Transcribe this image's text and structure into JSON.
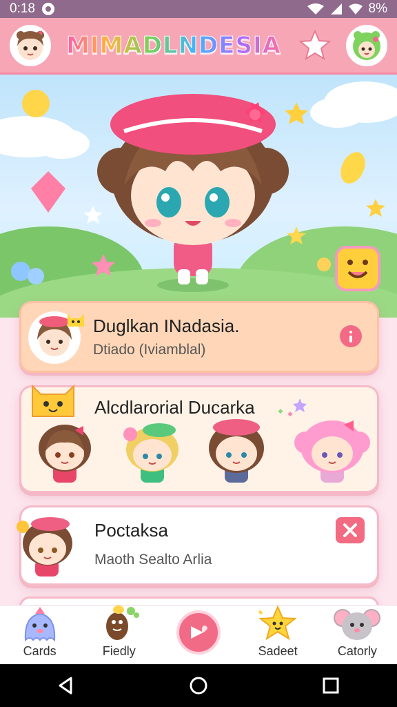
{
  "status_bar": {
    "time": "0:18",
    "battery": "8%"
  },
  "header": {
    "title": "MIMADLNDESIA"
  },
  "cards": [
    {
      "title": "Duglkan INadasia.",
      "subtitle": "Dtiado (Iviamblal)"
    },
    {
      "title": "Alcdlarorial Ducarka"
    },
    {
      "title": "Poctaksa",
      "subtitle": "Maoth Sealto Arlia"
    }
  ],
  "bottom_nav": {
    "items": [
      {
        "label": "Cards",
        "icon": "ghost-icon"
      },
      {
        "label": "Fiedly",
        "icon": "coffee-bean-icon"
      },
      {
        "label": "",
        "icon": "play-heart-icon"
      },
      {
        "label": "Sadeet",
        "icon": "star-character-icon"
      },
      {
        "label": "Catorly",
        "icon": "mouse-icon"
      }
    ]
  },
  "colors": {
    "header_bg": "#f7a6b6",
    "accent": "#f26b86",
    "card_highlight": "#ffd7b8"
  }
}
